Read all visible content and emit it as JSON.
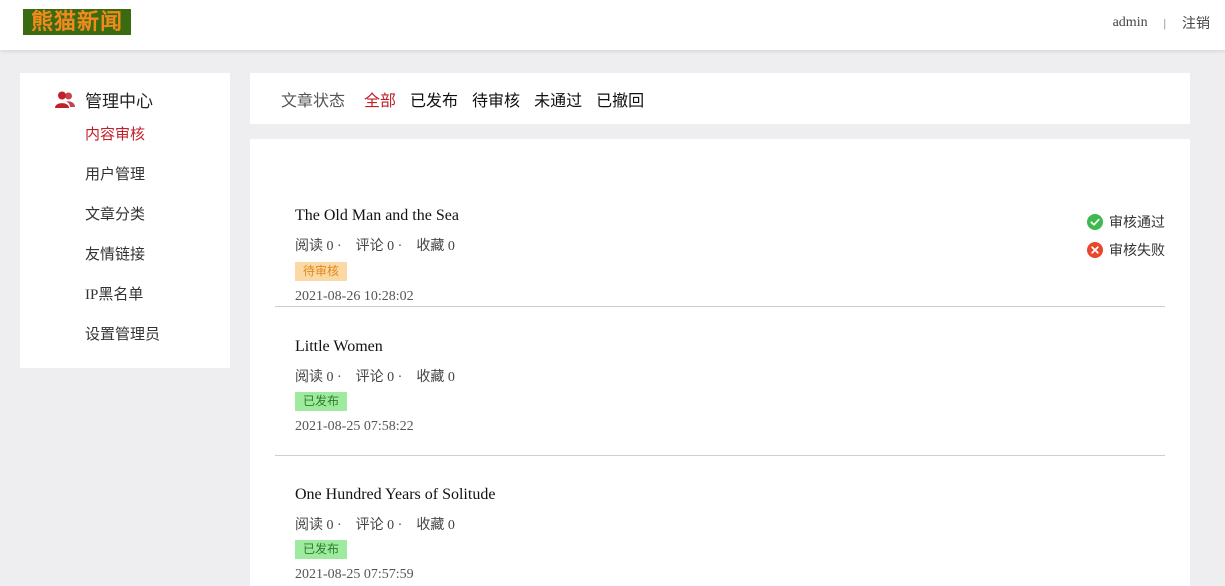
{
  "header": {
    "logo_text": "熊猫新闻",
    "user": "admin",
    "separator": "|",
    "logout": "注销"
  },
  "sidebar": {
    "title": "管理中心",
    "items": [
      {
        "label": "内容审核",
        "active": true
      },
      {
        "label": "用户管理"
      },
      {
        "label": "文章分类"
      },
      {
        "label": "友情链接"
      },
      {
        "label": "IP黑名单"
      },
      {
        "label": "设置管理员"
      }
    ]
  },
  "filter": {
    "label": "文章状态",
    "options": [
      "全部",
      "已发布",
      "待审核",
      "未通过",
      "已撤回"
    ],
    "active": "全部"
  },
  "actions": {
    "approve": "审核通过",
    "reject": "审核失败"
  },
  "articles": [
    {
      "title": "The Old Man and the Sea",
      "reads": "阅读 0 ·",
      "comments": "评论 0 ·",
      "favorites": "收藏 0",
      "status": "待审核",
      "date": "2021-08-26 10:28:02"
    },
    {
      "title": "Little Women",
      "reads": "阅读 0 ·",
      "comments": "评论 0 ·",
      "favorites": "收藏 0",
      "status": "已发布",
      "date": "2021-08-25 07:58:22"
    },
    {
      "title": "One Hundred Years of Solitude",
      "reads": "阅读 0 ·",
      "comments": "评论 0 ·",
      "favorites": "收藏 0",
      "status": "已发布",
      "date": "2021-08-25 07:57:59"
    }
  ],
  "colors": {
    "accent": "#c0202a",
    "approve_green": "#3dba4e",
    "reject_red": "#e8472c",
    "logo_bg": "#3a6b10",
    "logo_text": "#f08a1c"
  },
  "icons": {
    "sidebar_title": "user-group-icon",
    "approve": "check-circle-icon",
    "reject": "x-circle-icon"
  }
}
